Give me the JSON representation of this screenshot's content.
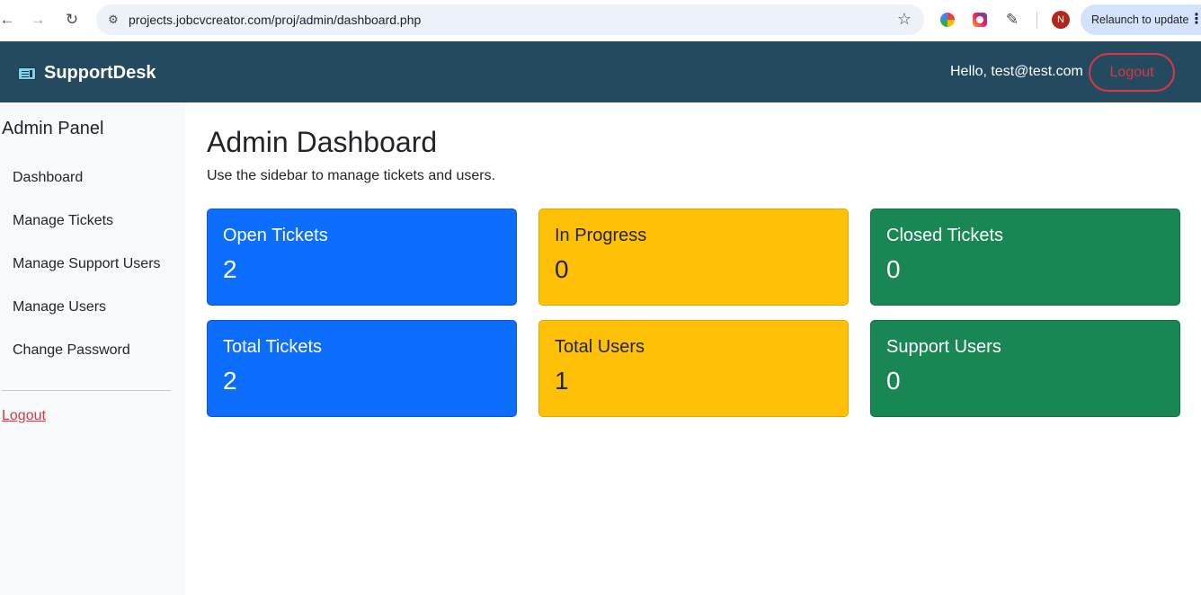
{
  "browser": {
    "url": "projects.jobcvcreator.com/proj/admin/dashboard.php",
    "profile_initial": "N",
    "relaunch_label": "Relaunch to update"
  },
  "navbar": {
    "brand": "SupportDesk",
    "greeting": "Hello, test@test.com",
    "logout_label": "Logout"
  },
  "sidebar": {
    "title": "Admin Panel",
    "items": [
      {
        "label": "Dashboard"
      },
      {
        "label": "Manage Tickets"
      },
      {
        "label": "Manage Support Users"
      },
      {
        "label": "Manage Users"
      },
      {
        "label": "Change Password"
      }
    ],
    "logout_label": "Logout"
  },
  "main": {
    "title": "Admin Dashboard",
    "subtitle": "Use the sidebar to manage tickets and users.",
    "cards": [
      {
        "label": "Open Tickets",
        "value": "2",
        "color": "#0d6efd"
      },
      {
        "label": "In Progress",
        "value": "0",
        "color": "#ffc107"
      },
      {
        "label": "Closed Tickets",
        "value": "0",
        "color": "#198754"
      },
      {
        "label": "Total Tickets",
        "value": "2",
        "color": "#0d6efd"
      },
      {
        "label": "Total Users",
        "value": "1",
        "color": "#ffc107"
      },
      {
        "label": "Support Users",
        "value": "0",
        "color": "#198754"
      }
    ]
  },
  "colors": {
    "navbar_bg": "#234a5e",
    "danger": "#dc3545",
    "sidebar_bg": "#f8f9fa"
  }
}
